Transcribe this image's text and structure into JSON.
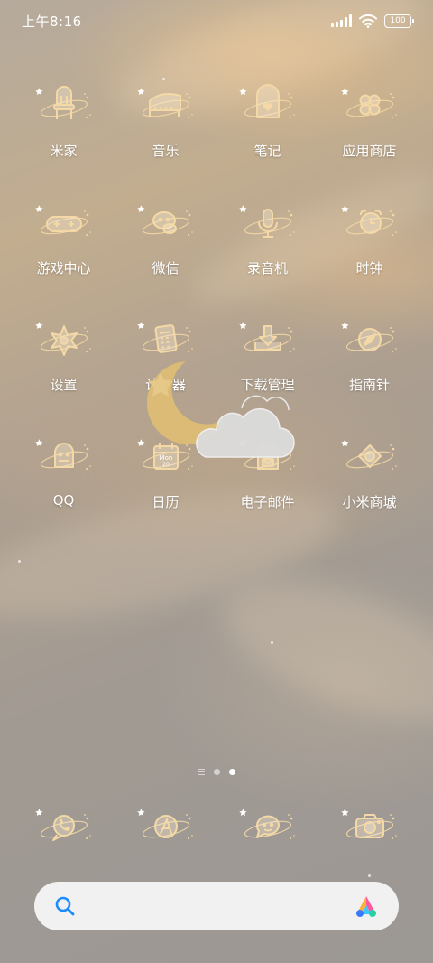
{
  "status_bar": {
    "time": "上午8:16",
    "battery": "100",
    "icons": [
      "signal-icon",
      "wifi-icon",
      "battery-icon"
    ]
  },
  "theme": {
    "icon_color": "#f4d9a6",
    "label_color": "#ffffff",
    "search_accent": "#1a8cff"
  },
  "apps": [
    {
      "label": "米家",
      "icon": "chair-icon"
    },
    {
      "label": "音乐",
      "icon": "piano-icon"
    },
    {
      "label": "笔记",
      "icon": "notebook-heart-icon"
    },
    {
      "label": "应用商店",
      "icon": "clover-icon"
    },
    {
      "label": "游戏中心",
      "icon": "gamepad-icon"
    },
    {
      "label": "微信",
      "icon": "chat-bubbles-icon"
    },
    {
      "label": "录音机",
      "icon": "microphone-icon"
    },
    {
      "label": "时钟",
      "icon": "alarm-clock-icon"
    },
    {
      "label": "设置",
      "icon": "gear-star-icon"
    },
    {
      "label": "计算器",
      "icon": "calculator-icon"
    },
    {
      "label": "下载管理",
      "icon": "download-tray-icon"
    },
    {
      "label": "指南针",
      "icon": "compass-icon"
    },
    {
      "label": "QQ",
      "icon": "penguin-icon"
    },
    {
      "label": "日历",
      "icon": "calendar-icon"
    },
    {
      "label": "电子邮件",
      "icon": "mailbox-icon"
    },
    {
      "label": "小米商城",
      "icon": "shop-bag-icon"
    }
  ],
  "calendar_icon_text": {
    "day_name": "Mon",
    "day_num": "20"
  },
  "page_indicator": {
    "pages": 3,
    "active": 3
  },
  "dock": [
    {
      "icon": "phone-icon"
    },
    {
      "icon": "browser-icon"
    },
    {
      "icon": "messages-icon"
    },
    {
      "icon": "camera-icon"
    }
  ],
  "search": {
    "placeholder": "",
    "icon": "search-icon",
    "assistant_icon": "xiaoai-icon"
  }
}
